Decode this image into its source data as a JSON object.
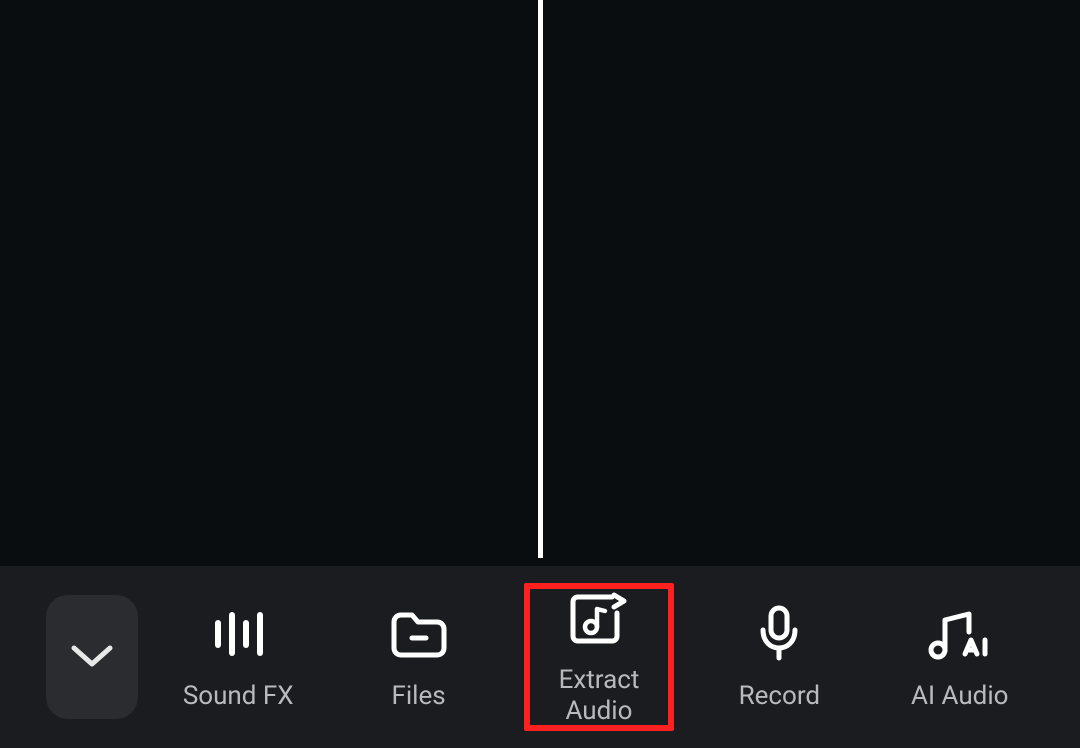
{
  "toolbar": {
    "items": [
      {
        "label": "Sound FX",
        "icon": "sound-fx-icon"
      },
      {
        "label": "Files",
        "icon": "folder-icon"
      },
      {
        "label": "Extract\nAudio",
        "icon": "extract-audio-icon",
        "highlighted": true
      },
      {
        "label": "Record",
        "icon": "mic-icon"
      },
      {
        "label": "AI Audio",
        "icon": "ai-audio-icon"
      }
    ],
    "collapse": {
      "icon": "chevron-down-icon"
    }
  }
}
